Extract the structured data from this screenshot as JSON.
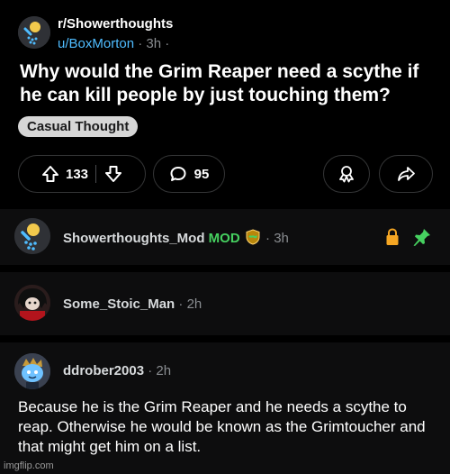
{
  "post": {
    "subreddit": "r/Showerthoughts",
    "author": "u/BoxMorton",
    "age": "3h",
    "title": "Why would the Grim Reaper need a scythe if he can kill people by just touching them?",
    "flair": "Casual Thought",
    "upvotes": "133",
    "comments": "95"
  },
  "comments": [
    {
      "author": "Showerthoughts_Mod",
      "badge": "MOD",
      "age": "3h"
    },
    {
      "author": "Some_Stoic_Man",
      "age": "2h"
    },
    {
      "author": "ddrober2003",
      "age": "2h",
      "body": "Because he is the Grim Reaper and he needs a scythe to reap. Otherwise he would be known as the Grimtoucher and that might get him on a list."
    }
  ],
  "watermark": "imgflip.com",
  "colors": {
    "user_link": "#4fbcff",
    "mod_green": "#46d160",
    "lock": "#f5a623",
    "pin": "#46d160"
  }
}
